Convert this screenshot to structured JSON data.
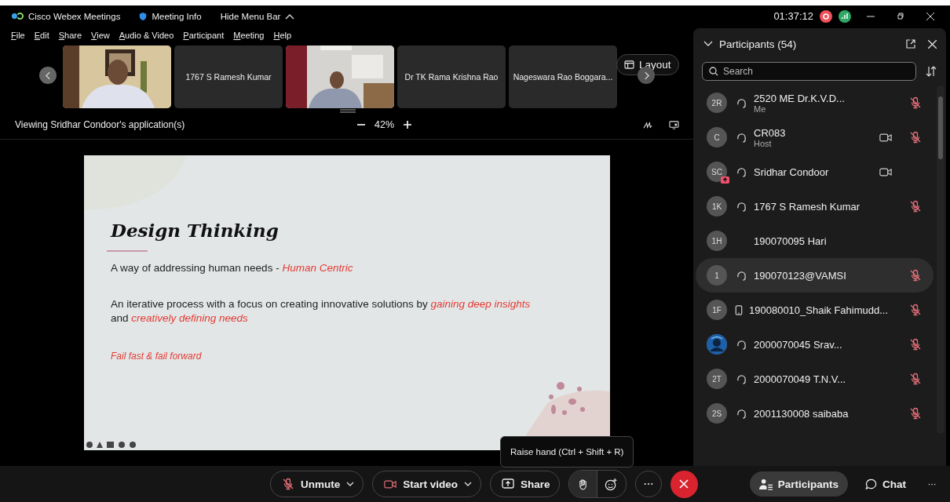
{
  "title_bar": {
    "app_name": "Cisco Webex Meetings",
    "meeting_info": "Meeting Info",
    "hide_menu": "Hide Menu Bar",
    "timer": "01:37:12"
  },
  "menu": [
    "File",
    "Edit",
    "Share",
    "View",
    "Audio & Video",
    "Participant",
    "Meeting",
    "Help"
  ],
  "video_strip": {
    "tiles": [
      {
        "kind": "video"
      },
      {
        "kind": "name",
        "label": "1767 S Ramesh Kumar"
      },
      {
        "kind": "video"
      },
      {
        "kind": "name",
        "label": "Dr TK Rama Krishna Rao"
      },
      {
        "kind": "name",
        "label": "Nageswara Rao Boggara..."
      }
    ],
    "layout_button": "Layout"
  },
  "share_bar": {
    "label": "Viewing Sridhar Condoor's application(s)",
    "zoom": "42%"
  },
  "slide": {
    "title": "Design Thinking",
    "lines": [
      "A way of addressing human needs - *Human Centric*",
      "An iterative process with a focus on creating innovative solutions by *gaining deep insights* and *creatively defining needs*"
    ],
    "tagline": "Fail fast & fail forward"
  },
  "participants": {
    "title": "Participants (54)",
    "search": {
      "placeholder": "Search"
    },
    "items": [
      {
        "kind": "initials",
        "initials": "2R",
        "name": "2520 ME Dr.K.V.D...",
        "role": "Me",
        "headset": true,
        "phone": false,
        "video": false,
        "muted": true,
        "sharing": false,
        "selected": false
      },
      {
        "kind": "initials",
        "initials": "C",
        "name": "CR083",
        "role": "Host",
        "headset": true,
        "phone": false,
        "video": true,
        "muted": true,
        "sharing": false,
        "selected": false
      },
      {
        "kind": "initials",
        "initials": "SC",
        "name": "Sridhar Condoor",
        "headset": true,
        "phone": false,
        "video": true,
        "muted": false,
        "sharing": true,
        "selected": false
      },
      {
        "kind": "initials",
        "initials": "1K",
        "name": "1767 S Ramesh Kumar",
        "headset": true,
        "phone": false,
        "video": false,
        "muted": true,
        "sharing": false,
        "selected": false
      },
      {
        "kind": "initials",
        "initials": "1H",
        "name": "190070095 Hari",
        "headset": false,
        "phone": false,
        "video": false,
        "muted": false,
        "sharing": false,
        "selected": false
      },
      {
        "kind": "initials",
        "initials": "1",
        "name": "190070123@VAMSI",
        "headset": true,
        "phone": false,
        "video": false,
        "muted": true,
        "sharing": false,
        "selected": true
      },
      {
        "kind": "initials",
        "initials": "1F",
        "name": "190080010_Shaik Fahimudd...",
        "headset": false,
        "phone": true,
        "video": false,
        "muted": true,
        "sharing": false,
        "selected": false
      },
      {
        "kind": "picture",
        "name": "2000070045 Srav...",
        "headset": true,
        "phone": false,
        "video": false,
        "muted": true,
        "sharing": false,
        "selected": false
      },
      {
        "kind": "initials",
        "initials": "2T",
        "name": "2000070049 T.N.V...",
        "headset": true,
        "phone": false,
        "video": false,
        "muted": true,
        "sharing": false,
        "selected": false
      },
      {
        "kind": "initials",
        "initials": "2S",
        "name": "2001130008 saibaba",
        "headset": true,
        "phone": false,
        "video": false,
        "muted": true,
        "sharing": false,
        "selected": false
      }
    ]
  },
  "toolbar": {
    "controls": [
      {
        "kind": "unmute",
        "label": "Unmute"
      },
      {
        "kind": "video",
        "label": "Start video"
      },
      {
        "kind": "share",
        "label": "Share"
      },
      {
        "kind": "reactions"
      },
      {
        "kind": "more"
      },
      {
        "kind": "leave"
      }
    ],
    "tooltip": "Raise hand (Ctrl + Shift + R)",
    "panel_tabs": [
      {
        "kind": "participants",
        "label": "Participants",
        "selected": true
      },
      {
        "kind": "chat",
        "label": "Chat",
        "selected": false
      }
    ]
  }
}
